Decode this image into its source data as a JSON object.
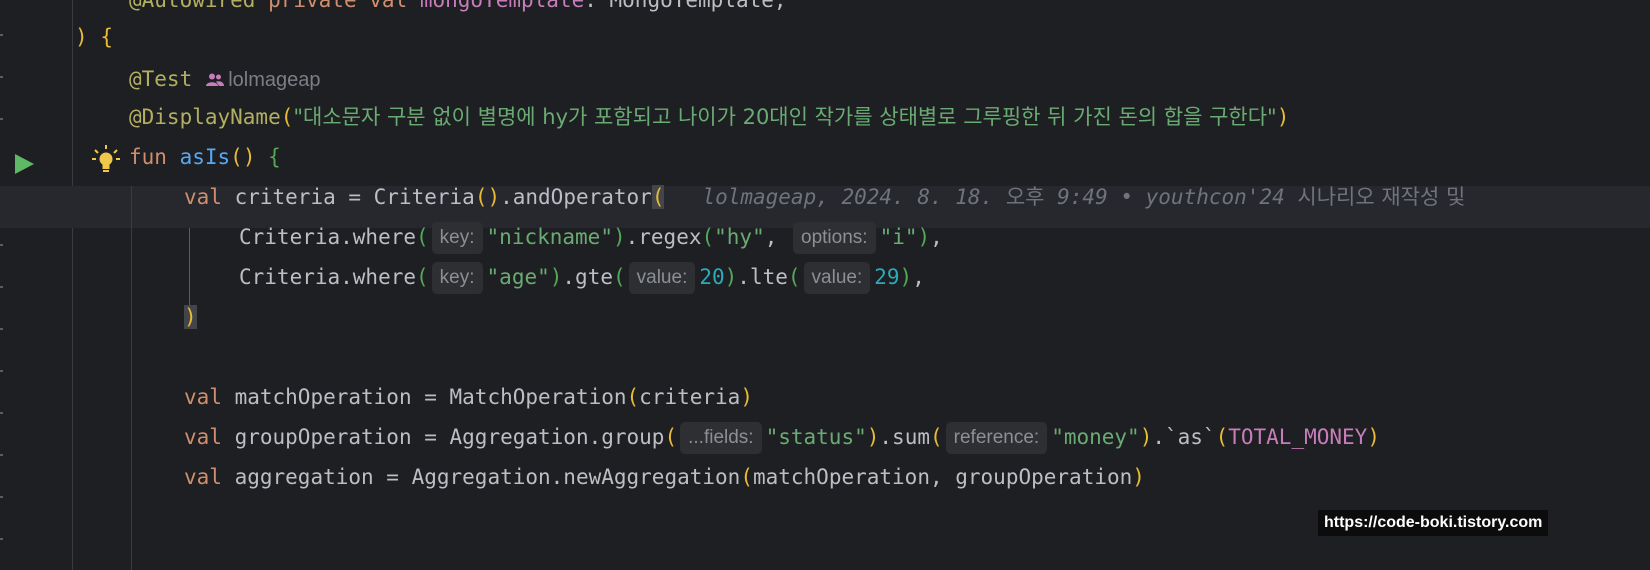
{
  "code": {
    "line0": {
      "annotation": "@Autowired",
      "private_kw": "private",
      "val_kw": "val",
      "name": "mongoTemplate",
      "type": ": MongoTemplate,"
    },
    "line1": {
      "paren": ")",
      "brace": "{"
    },
    "line2": {
      "annotation": "@Test",
      "author": "lolmageap"
    },
    "line3": {
      "annotation": "@DisplayName",
      "open": "(",
      "text": "\"대소문자 구분 없이 별명에 hy가 포함되고 나이가 20대인 작가를 상태별로 그루핑한 뒤 가진 돈의 합을 구한다\"",
      "close": ")"
    },
    "line4": {
      "fun_kw": "fun",
      "name": "asIs",
      "parens": "()",
      "brace": "{"
    },
    "line5": {
      "val_kw": "val",
      "left": " criteria = Criteria",
      "parens": "()",
      "call": ".andOperator",
      "open": "(",
      "blame": "lolmageap, 2024. 8. 18. ",
      "blame_kr1": "오후",
      "blame_time": " 9:49 • youthcon'24 ",
      "blame_kr2": "시나리오 재작성 및"
    },
    "line6": {
      "prefix": "Criteria.where",
      "open1": "(",
      "hint_key": "key:",
      "str1": "\"nickname\"",
      "close1": ")",
      "mid": ".regex",
      "open2": "(",
      "str2": "\"hy\"",
      "comma": ", ",
      "hint_options": "options:",
      "str3": "\"i\"",
      "close2": ")",
      "end": ","
    },
    "line7": {
      "prefix": "Criteria.where",
      "open1": "(",
      "hint_key": "key:",
      "str1": "\"age\"",
      "close1": ")",
      "mid1": ".gte",
      "open2": "(",
      "hint_value1": "value:",
      "num1": "20",
      "close2": ")",
      "mid2": ".lte",
      "open3": "(",
      "hint_value2": "value:",
      "num2": "29",
      "close3": ")",
      "end": ","
    },
    "line8": {
      "paren": ")"
    },
    "line10": {
      "val_kw": "val",
      "left": " matchOperation = MatchOperation",
      "open": "(",
      "arg": "criteria",
      "close": ")"
    },
    "line11": {
      "val_kw": "val",
      "left": " groupOperation = Aggregation.group",
      "open1": "(",
      "hint_fields": "...fields:",
      "str1": "\"status\"",
      "close1": ")",
      "mid": ".sum",
      "open2": "(",
      "hint_reference": "reference:",
      "str2": "\"money\"",
      "close2": ")",
      "as_call": ".`as`",
      "open3": "(",
      "const": "TOTAL_MONEY",
      "close3": ")"
    },
    "line12": {
      "val_kw": "val",
      "left": " aggregation = Aggregation.newAggregation",
      "open": "(",
      "args": "matchOperation, groupOperation",
      "close": ")"
    }
  },
  "icons": {
    "run": "run-test-icon",
    "intention": "lightbulb-icon",
    "author": "users-icon"
  },
  "watermark": "https://code-boki.tistory.com",
  "colors": {
    "background": "#1e1f22",
    "keyword": "#cf8e6d",
    "annotation": "#b3ae60",
    "function": "#56a8f5",
    "string": "#6aab73",
    "number": "#2aacb8",
    "constant": "#c77dbb",
    "run_icon": "#5fb865",
    "bulb_icon": "#f0c94a"
  }
}
